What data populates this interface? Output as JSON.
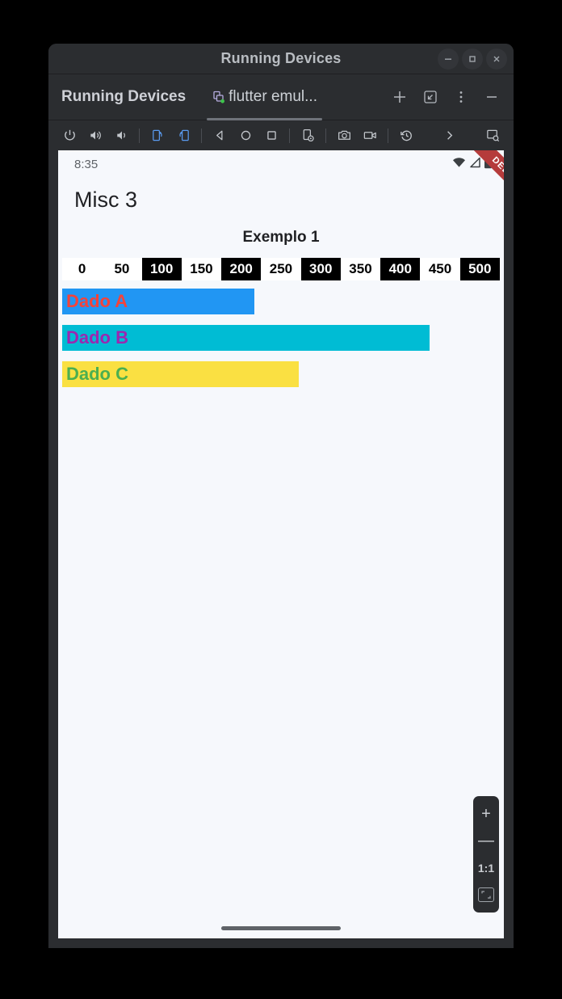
{
  "window": {
    "title": "Running Devices",
    "controls": [
      {
        "name": "minimize",
        "glyph": "—"
      },
      {
        "name": "maximize",
        "glyph": "▫"
      },
      {
        "name": "close",
        "glyph": "✕"
      }
    ]
  },
  "tab_row": {
    "tool_window_title": "Running Devices",
    "device_tab_label": "flutter emul...",
    "actions": [
      {
        "name": "add-device",
        "label": "+"
      },
      {
        "name": "collapse-window",
        "label": "↙"
      },
      {
        "name": "more-options",
        "label": "⋮"
      },
      {
        "name": "hide-window",
        "label": "—"
      }
    ]
  },
  "emulator_toolbar": {
    "buttons": [
      {
        "name": "power",
        "title": "Power"
      },
      {
        "name": "volume-up",
        "title": "Volume Up"
      },
      {
        "name": "volume-down",
        "title": "Volume Down"
      },
      {
        "name": "rotate-left",
        "title": "Rotate Left"
      },
      {
        "name": "rotate-right",
        "title": "Rotate Right"
      },
      {
        "name": "back",
        "title": "Back"
      },
      {
        "name": "home",
        "title": "Home"
      },
      {
        "name": "overview",
        "title": "Overview"
      },
      {
        "name": "device-settings",
        "title": "Device Settings"
      },
      {
        "name": "screenshot",
        "title": "Take Screenshot"
      },
      {
        "name": "record-screen",
        "title": "Record Screen"
      },
      {
        "name": "rollback",
        "title": "Snapshots"
      },
      {
        "name": "more",
        "title": "More"
      },
      {
        "name": "device-manager",
        "title": "Device Manager"
      }
    ]
  },
  "device": {
    "status_bar": {
      "time": "8:35",
      "icons": [
        "wifi-icon",
        "signal-icon",
        "battery-icon"
      ]
    },
    "debug_banner": "DEBUG",
    "screen_title": "Misc 3",
    "zoom_panel": {
      "zoom_in": "+",
      "zoom_out": "—",
      "actual_size": "1:1",
      "fit_to_screen": "fit-icon"
    }
  },
  "chart_data": {
    "type": "bar",
    "orientation": "horizontal",
    "title": "Exemplo 1",
    "xlabel": "",
    "ylabel": "",
    "xlim": [
      0,
      500
    ],
    "grid": false,
    "legend": "none",
    "axis_ticks": [
      {
        "label": "0",
        "inverted": false
      },
      {
        "label": "50",
        "inverted": false
      },
      {
        "label": "100",
        "inverted": true
      },
      {
        "label": "150",
        "inverted": false
      },
      {
        "label": "200",
        "inverted": true
      },
      {
        "label": "250",
        "inverted": false
      },
      {
        "label": "300",
        "inverted": true
      },
      {
        "label": "350",
        "inverted": false
      },
      {
        "label": "400",
        "inverted": true
      },
      {
        "label": "450",
        "inverted": false
      },
      {
        "label": "500",
        "inverted": true
      }
    ],
    "categories": [
      "Dado A",
      "Dado B",
      "Dado C"
    ],
    "values": [
      220,
      420,
      270
    ],
    "bars": [
      {
        "label": "Dado A",
        "value": 220,
        "bar_color": "#2196f3",
        "label_color": "#f4433a"
      },
      {
        "label": "Dado B",
        "value": 420,
        "bar_color": "#00bcd4",
        "label_color": "#9c27b0"
      },
      {
        "label": "Dado C",
        "value": 270,
        "bar_color": "#fae042",
        "label_color": "#4caf50"
      }
    ]
  },
  "colors": {
    "ide_background": "#2b2d30",
    "device_background": "#f6f8fc",
    "accent_blue": "#5a9bf0",
    "debug_red": "#b53b3b"
  }
}
